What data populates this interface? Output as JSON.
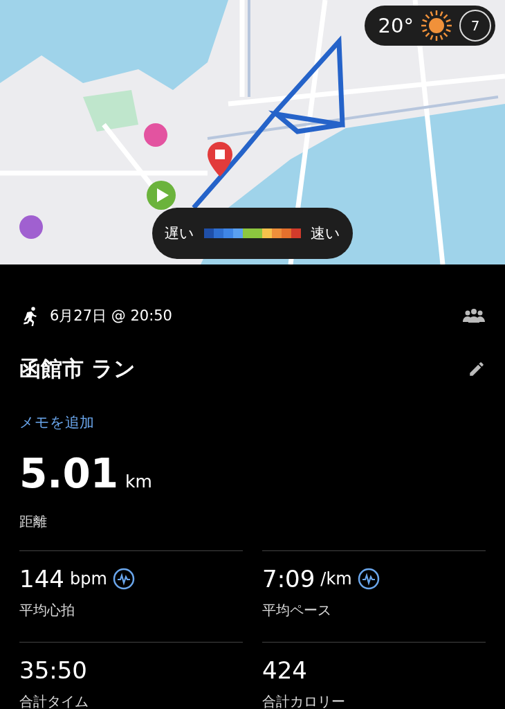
{
  "map": {
    "kind": "picture",
    "weather": {
      "temperature": "20°",
      "wind": "7"
    },
    "legend": {
      "slow": "遅い",
      "fast": "速い",
      "swatches": [
        {
          "color": "#1f4fa8"
        },
        {
          "color": "#2f6fd0"
        },
        {
          "color": "#3f86e6"
        },
        {
          "color": "#5aa0f0"
        },
        {
          "color": "#8cc63f"
        },
        {
          "color": "#8cc63f"
        },
        {
          "color": "#f5c24c"
        },
        {
          "color": "#ee8f3a"
        },
        {
          "color": "#e5702c"
        },
        {
          "color": "#d23b2b"
        }
      ]
    }
  },
  "activity": {
    "date": "6月27日 @ 20:50",
    "title": "函館市 ラン",
    "memo_link": "メモを追加"
  },
  "distance": {
    "value": "5.01",
    "unit": "km",
    "label": "距離"
  },
  "stats": [
    {
      "value": "144",
      "unit": "bpm",
      "label": "平均心拍",
      "graph": true
    },
    {
      "value": "7:09",
      "unit": "/km",
      "label": "平均ペース",
      "graph": true
    },
    {
      "value": "35:50",
      "label": "合計タイム",
      "graph": false
    },
    {
      "value": "424",
      "label": "合計カロリー",
      "graph": false
    }
  ]
}
